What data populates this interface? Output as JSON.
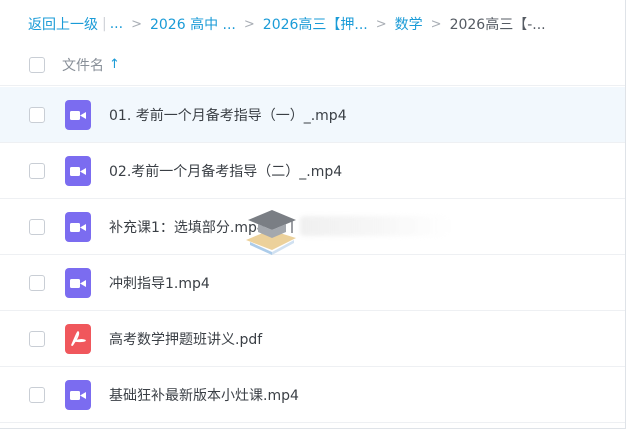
{
  "breadcrumb": {
    "back": "返回上一级",
    "ellipsis": "...",
    "items": [
      "2026 高中 ...",
      "2026高三【押...",
      "数学"
    ],
    "current": "2026高三【-..."
  },
  "header": {
    "name_label": "文件名",
    "sort_icon": "arrow-up-icon"
  },
  "files": [
    {
      "name": "01. 考前一个月备考指导（一）_.mp4",
      "type": "video",
      "icon": "video-file-icon",
      "selected": true
    },
    {
      "name": "02.考前一个月备考指导（二）_.mp4",
      "type": "video",
      "icon": "video-file-icon",
      "selected": false
    },
    {
      "name": "补充课1：选填部分.mp4",
      "type": "video",
      "icon": "video-file-icon",
      "selected": false
    },
    {
      "name": "冲刺指导1.mp4",
      "type": "video",
      "icon": "video-file-icon",
      "selected": false
    },
    {
      "name": "高考数学押题班讲义.pdf",
      "type": "pdf",
      "icon": "pdf-file-icon",
      "selected": false
    },
    {
      "name": "基础狂补最新版本小灶课.mp4",
      "type": "video",
      "icon": "video-file-icon",
      "selected": false
    }
  ],
  "colors": {
    "link": "#1a9bd7",
    "video_icon": "#7b6cf0",
    "pdf_icon": "#f0575c",
    "selected_row": "#f2f8fd"
  }
}
